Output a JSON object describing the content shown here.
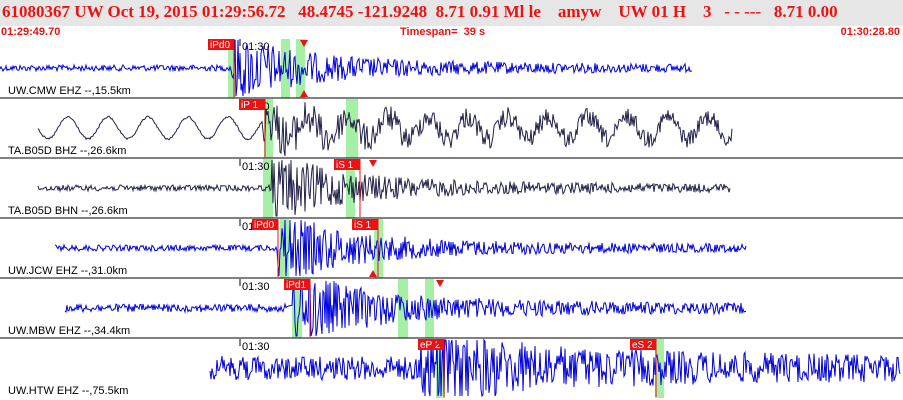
{
  "header": {
    "event_line": "61080367 UW Oct 19, 2015 01:29:56.72   48.4745 -121.9248  8.71 0.91 Ml le    amyw    UW 01 H    3   - - ---   8.71 0.00",
    "start_time": "01:29:49.70",
    "timespan": "Timespan=  39 s",
    "end_time": "01:30:28.80"
  },
  "colors": {
    "header_bg": "#e6e6e6",
    "header_text": "#ee1111",
    "trace_blue": "#0000dd",
    "trace_navy": "#22224a",
    "pick_box": "#ee1111",
    "window_band": "#a6f0a6",
    "divider": "#000000"
  },
  "icons": {
    "pick_marker": "red-triangle-icon"
  },
  "panels": [
    {
      "label": "UW.CMW EHZ --,15.5km",
      "time_tick": "01:30",
      "trace_style": "blue",
      "picks": [
        {
          "label": "iPd0",
          "kind": "P"
        }
      ]
    },
    {
      "label": "TA.B05D BHZ --,26.6km",
      "time_tick": "01:30",
      "trace_style": "navy",
      "picks": [
        {
          "label": "iP 1",
          "kind": "P"
        }
      ]
    },
    {
      "label": "TA.B05D BHN --,26.6km",
      "time_tick": "01:30",
      "trace_style": "navy",
      "picks": [
        {
          "label": "iS 1",
          "kind": "S"
        }
      ]
    },
    {
      "label": "UW.JCW EHZ --,31.0km",
      "time_tick": "01:30",
      "trace_style": "blue",
      "picks": [
        {
          "label": "iPd0",
          "kind": "P"
        },
        {
          "label": "iS 1",
          "kind": "S"
        }
      ]
    },
    {
      "label": "UW.MBW EHZ --,34.4km",
      "time_tick": "01:30",
      "trace_style": "blue",
      "picks": [
        {
          "label": "iPd1",
          "kind": "P"
        }
      ]
    },
    {
      "label": "UW.HTW EHZ --,75.5km",
      "time_tick": "01:30",
      "trace_style": "blue",
      "picks": [
        {
          "label": "eP 2",
          "kind": "P"
        },
        {
          "label": "eS 2",
          "kind": "S"
        }
      ]
    }
  ]
}
